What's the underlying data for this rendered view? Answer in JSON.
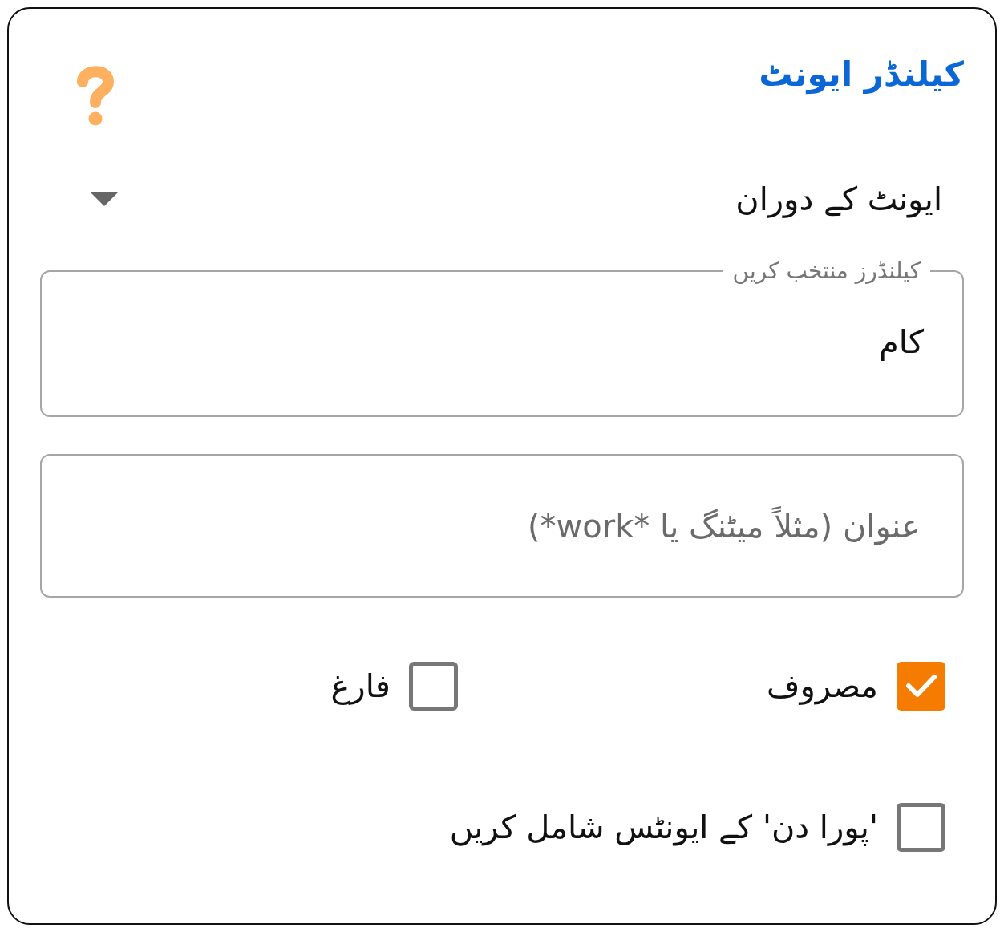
{
  "header": {
    "title": "کیلنڈر ایونٹ"
  },
  "dropdown": {
    "value": "ایونٹ کے دوران"
  },
  "calendars_field": {
    "label": "کیلنڈرز منتخب کریں",
    "value": "کام"
  },
  "title_field": {
    "placeholder": "عنوان (مثلاً میٹنگ یا *work*)"
  },
  "availability": [
    {
      "label": "مصروف",
      "checked": true
    },
    {
      "label": "فارغ",
      "checked": false
    }
  ],
  "all_day": {
    "label": "'پورا دن' کے ایونٹس شامل کریں",
    "checked": false
  }
}
